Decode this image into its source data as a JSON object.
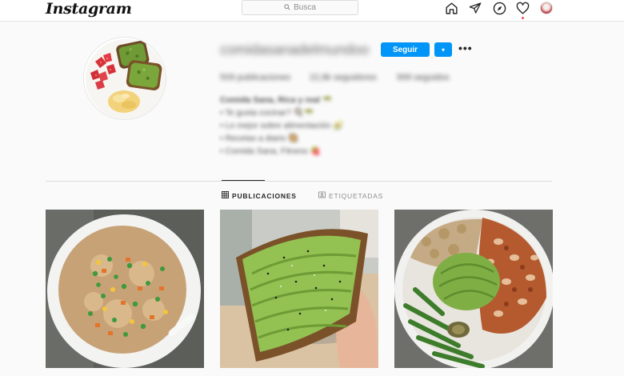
{
  "topbar": {
    "logo": "Instagram",
    "search_placeholder": "Busca",
    "icons": [
      "home-icon",
      "direct-icon",
      "explore-icon",
      "activity-heart-icon",
      "profile-avatar"
    ]
  },
  "profile": {
    "username": "comidasanadelmundoo",
    "follow_label": "Seguir",
    "dropdown_label": "▾",
    "more_label": "•••",
    "stats": {
      "posts": "509 publicaciones",
      "followers": "22,8k seguidores",
      "following": "999 seguidos"
    },
    "bio": [
      "Comida Sana, Rica y real 🥗",
      "• Te gusta cocinar? 🍳🥗",
      "• Lo mejor sobre alimentación 🥑",
      "• Recetas a diario 🥘",
      "• Comida Sana, Fitness 🍓"
    ]
  },
  "tabs": [
    {
      "label": "PUBLICACIONES",
      "icon": "grid-icon",
      "active": true
    },
    {
      "label": "ETIQUETADAS",
      "icon": "tag-icon",
      "active": false
    }
  ],
  "colors": {
    "accent": "#0095f6",
    "background": "#fafafa",
    "notification": "#ed4956"
  }
}
